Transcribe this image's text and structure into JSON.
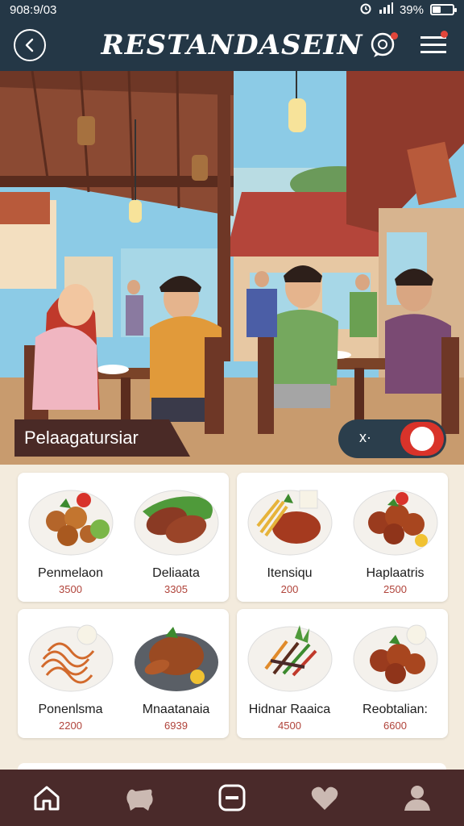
{
  "status": {
    "time": "908:9/03",
    "battery": "39%",
    "battery_level": 0.39
  },
  "header": {
    "title": "RESTANDASEIN",
    "chat_badge": true,
    "menu_badge": true
  },
  "hero": {
    "caption": "Pelaagatursiar",
    "toggle_label": "x·"
  },
  "menu": {
    "cards": [
      {
        "dishes": [
          {
            "name": "Penmelaon",
            "price": "3500",
            "icon": "meatball-plate-icon"
          },
          {
            "name": "Deliaata",
            "price": "3305",
            "icon": "grilled-fish-plate-icon"
          }
        ]
      },
      {
        "dishes": [
          {
            "name": "Itensiqu",
            "price": "200",
            "icon": "beef-fries-plate-icon"
          },
          {
            "name": "Haplaatris",
            "price": "2500",
            "icon": "fried-chicken-plate-icon"
          }
        ]
      },
      {
        "dishes": [
          {
            "name": "Ponenlsma",
            "price": "2200",
            "icon": "noodle-plate-icon"
          },
          {
            "name": "Mnaatanaia",
            "price": "6939",
            "icon": "roast-chicken-plate-icon"
          }
        ]
      },
      {
        "dishes": [
          {
            "name": "Hidnar Raaica",
            "price": "4500",
            "icon": "stir-fry-plate-icon"
          },
          {
            "name": "Reobtalian:",
            "price": "6600",
            "icon": "glazed-chicken-plate-icon"
          }
        ]
      }
    ]
  },
  "bottom_nav": [
    "home-icon",
    "pet-icon",
    "minus-box-icon",
    "heart-icon",
    "profile-icon"
  ],
  "colors": {
    "header": "#243746",
    "accent": "#d9332a",
    "nav": "#4a2a2a",
    "price": "#b0433a",
    "background": "#f3ebdd"
  }
}
